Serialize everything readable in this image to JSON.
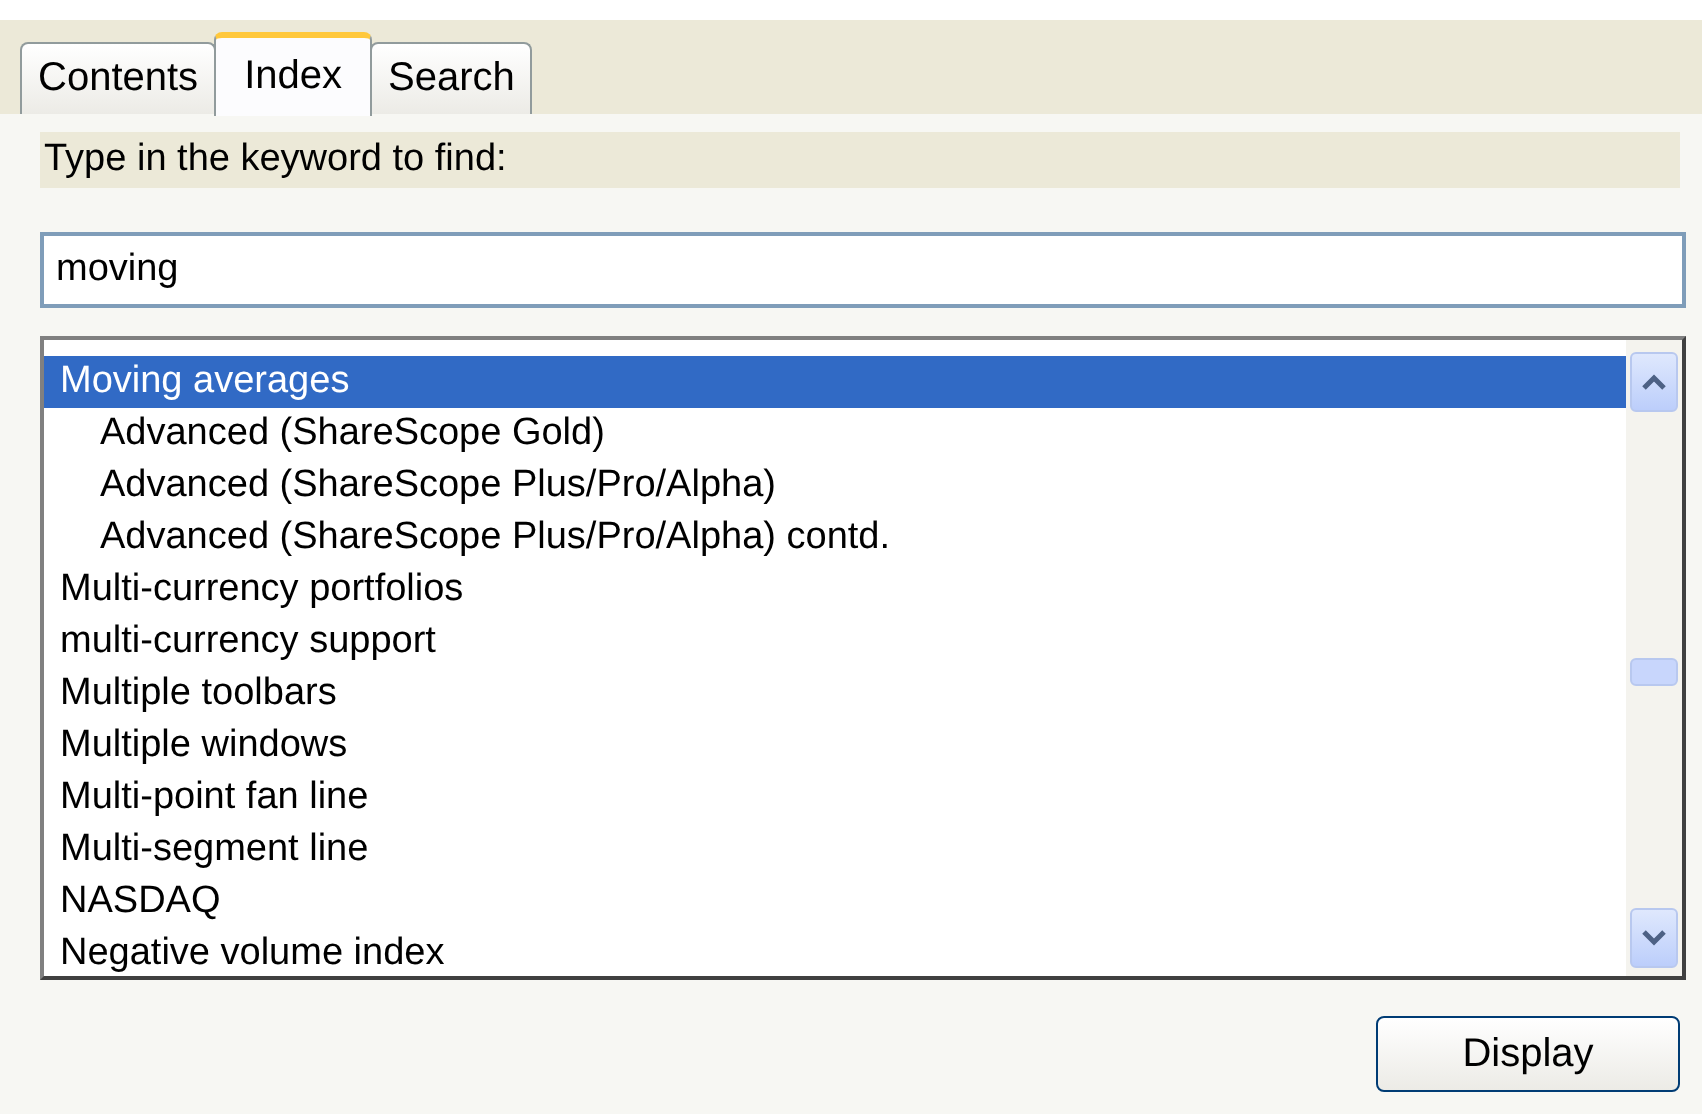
{
  "tabs": [
    {
      "label": "Contents",
      "selected": false
    },
    {
      "label": "Index",
      "selected": true
    },
    {
      "label": "Search",
      "selected": false
    }
  ],
  "keyword_label": "Type in the keyword to find:",
  "keyword_field": {
    "value": "moving"
  },
  "index_list": [
    {
      "label": "Moving averages",
      "selected": true,
      "children": [
        {
          "label": "Advanced (ShareScope Gold)",
          "selected": false
        },
        {
          "label": "Advanced (ShareScope Plus/Pro/Alpha)",
          "selected": false
        },
        {
          "label": "Advanced (ShareScope Plus/Pro/Alpha) contd.",
          "selected": false
        }
      ]
    },
    {
      "label": "Multi-currency portfolios",
      "selected": false
    },
    {
      "label": "multi-currency support",
      "selected": false
    },
    {
      "label": "Multiple toolbars",
      "selected": false
    },
    {
      "label": "Multiple windows",
      "selected": false
    },
    {
      "label": "Multi-point fan line",
      "selected": false
    },
    {
      "label": "Multi-segment line",
      "selected": false
    },
    {
      "label": "NASDAQ",
      "selected": false
    },
    {
      "label": "Negative volume index",
      "selected": false
    }
  ],
  "buttons": [
    "Display"
  ]
}
